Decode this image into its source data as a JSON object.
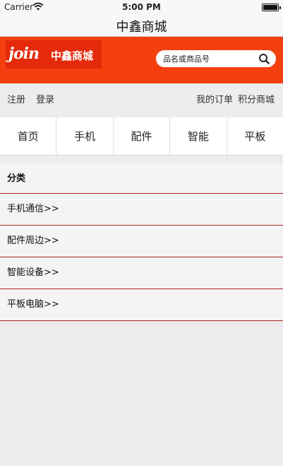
{
  "status_bar": {
    "carrier": "Carrier",
    "time": "5:00 PM"
  },
  "nav": {
    "title": "中鑫商城"
  },
  "header": {
    "logo_mark": "join",
    "logo_text": "中鑫商城",
    "search": {
      "placeholder": "品名或商品号"
    }
  },
  "account": {
    "register": "注册",
    "login": "登录",
    "orders": "我的订单",
    "points": "积分商城"
  },
  "tabs": [
    {
      "label": "首页"
    },
    {
      "label": "手机"
    },
    {
      "label": "配件"
    },
    {
      "label": "智能"
    },
    {
      "label": "平板"
    }
  ],
  "category": {
    "title": "分类",
    "items": [
      {
        "label": "手机通信>>"
      },
      {
        "label": "配件周边>>"
      },
      {
        "label": "智能设备>>"
      },
      {
        "label": "平板电脑>>"
      }
    ]
  },
  "colors": {
    "brand": "#f4400f",
    "logo_bg": "#e42a0a",
    "divider": "#b0231a"
  },
  "icons": [
    "wifi-icon",
    "battery-icon",
    "search-icon"
  ]
}
